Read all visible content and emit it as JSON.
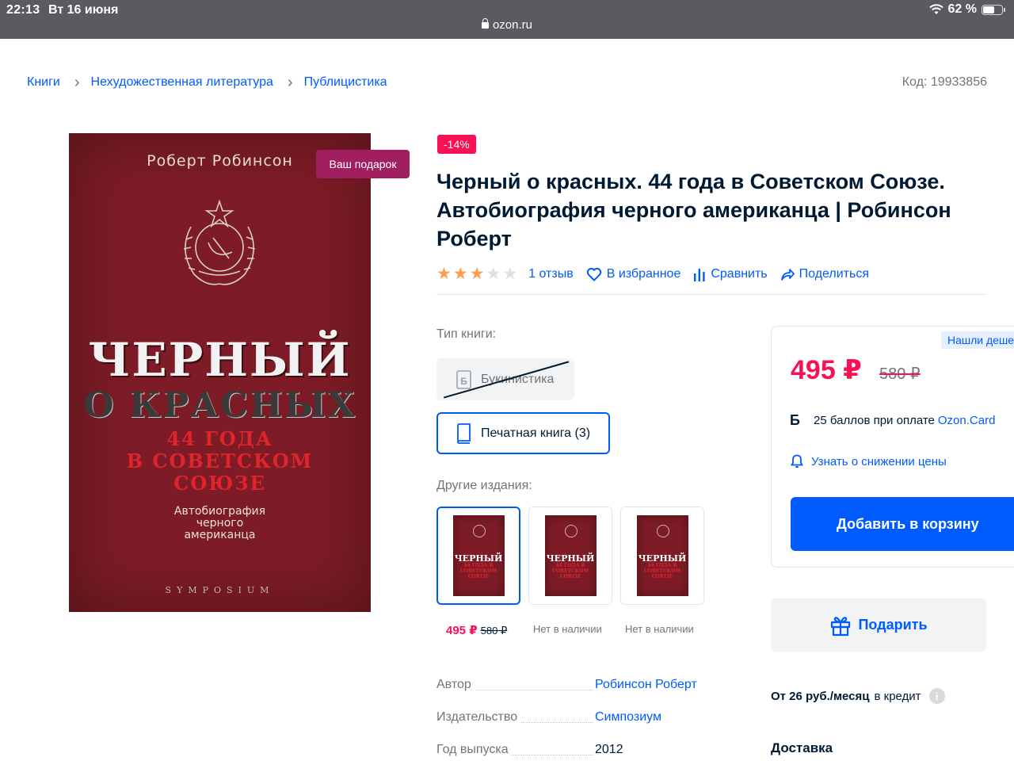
{
  "status_bar": {
    "time": "22:13",
    "date": "Вт 16 июня",
    "battery": "62 %",
    "battery_level": 0.62,
    "url": "ozon.ru"
  },
  "breadcrumb": {
    "items": [
      "Книги",
      "Нехудожественная литература",
      "Публицистика"
    ]
  },
  "sku": "Код: 19933856",
  "cover": {
    "author": "Роберт Робинсон",
    "title_line1": "ЧЕРНЫЙ",
    "title_line2": "О КРАСНЫХ",
    "subtitle": [
      "44 ГОДА",
      "В СОВЕТСКОМ",
      "СОЮЗЕ"
    ],
    "description": [
      "Автобиография",
      "черного",
      "американца"
    ],
    "publisher": "SYMPOSIUM",
    "gift_tag": "Ваш подарок"
  },
  "mini_cover": {
    "title": "ЧЕРНЫЙ",
    "subtitle": "44 ГОДА В СОВЕТСКОМ СОЮЗЕ"
  },
  "product": {
    "discount": "-14%",
    "title": "Черный о красных. 44 года в Советском Союзе. Автобиография черного американца | Робинсон Роберт",
    "rating": 3,
    "rating_max": 5,
    "reviews": "1 отзыв",
    "favorite": "В избранное",
    "compare": "Сравнить",
    "share": "Поделиться"
  },
  "book_type": {
    "label": "Тип книги:",
    "options": [
      {
        "label": "Букинистика",
        "icon": "Б"
      },
      {
        "label": "Печатная книга (3)"
      }
    ]
  },
  "editions": {
    "label": "Другие издания:",
    "items": [
      {
        "price": "495 ₽",
        "old_price": "580 ₽"
      },
      {
        "status": "Нет в наличии"
      },
      {
        "status": "Нет в наличии"
      }
    ]
  },
  "specs": [
    {
      "key": "Автор",
      "value": "Робинсон Роберт"
    },
    {
      "key": "Издательство",
      "value": "Симпозиум"
    },
    {
      "key": "Год выпуска",
      "value": "2012"
    }
  ],
  "offer": {
    "cheaper_badge": "Нашли деше",
    "price": "495 ₽",
    "old_price": "580 ₽",
    "bonus_icon": "Б",
    "bonus_text": "25 баллов при оплате",
    "bonus_link": "Ozon.Card",
    "notify": "Узнать о снижении цены",
    "add_to_cart": "Добавить в корзину",
    "gift": "Подарить",
    "credit_bold": "От 26 руб./месяц",
    "credit_rest": "в кредит",
    "info_icon": "i",
    "delivery": "Доставка"
  },
  "colors": {
    "accent": "#005bff",
    "sale": "#f91155",
    "gift_tag": "#a11f5f",
    "cover": "#7d1c26"
  }
}
